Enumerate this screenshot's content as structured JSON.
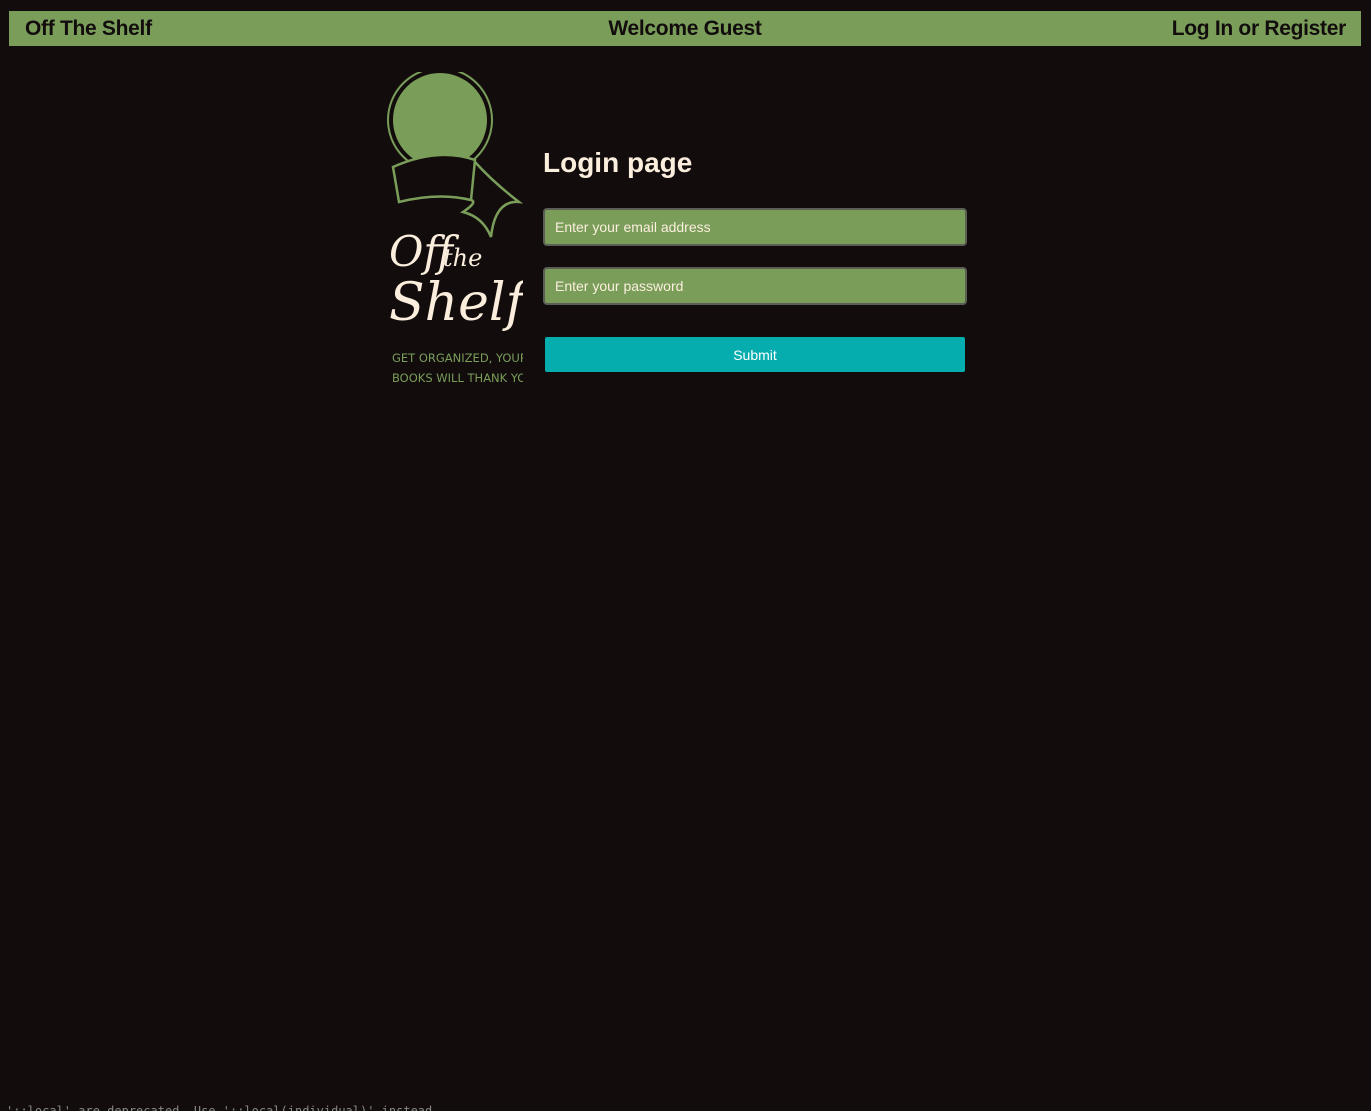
{
  "header": {
    "brand": "Off The Shelf",
    "welcome": "Welcome Guest",
    "auth_link": "Log In or Register"
  },
  "logo": {
    "title_line1": "Off",
    "title_line1b": "the",
    "title_line2": "Shelf",
    "tagline_line1": "GET ORGANIZED, YOUR",
    "tagline_line2": "BOOKS WILL THANK YOU"
  },
  "login": {
    "heading": "Login page",
    "email_placeholder": "Enter your email address",
    "password_placeholder": "Enter your password",
    "submit_label": "Submit"
  },
  "console": {
    "text": "'::local' are deprecated. Use '::local(individual)' instead."
  },
  "colors": {
    "background": "#120c0c",
    "accent_green": "#7a9e5a",
    "cream": "#fbeedd",
    "teal": "#06adae"
  }
}
